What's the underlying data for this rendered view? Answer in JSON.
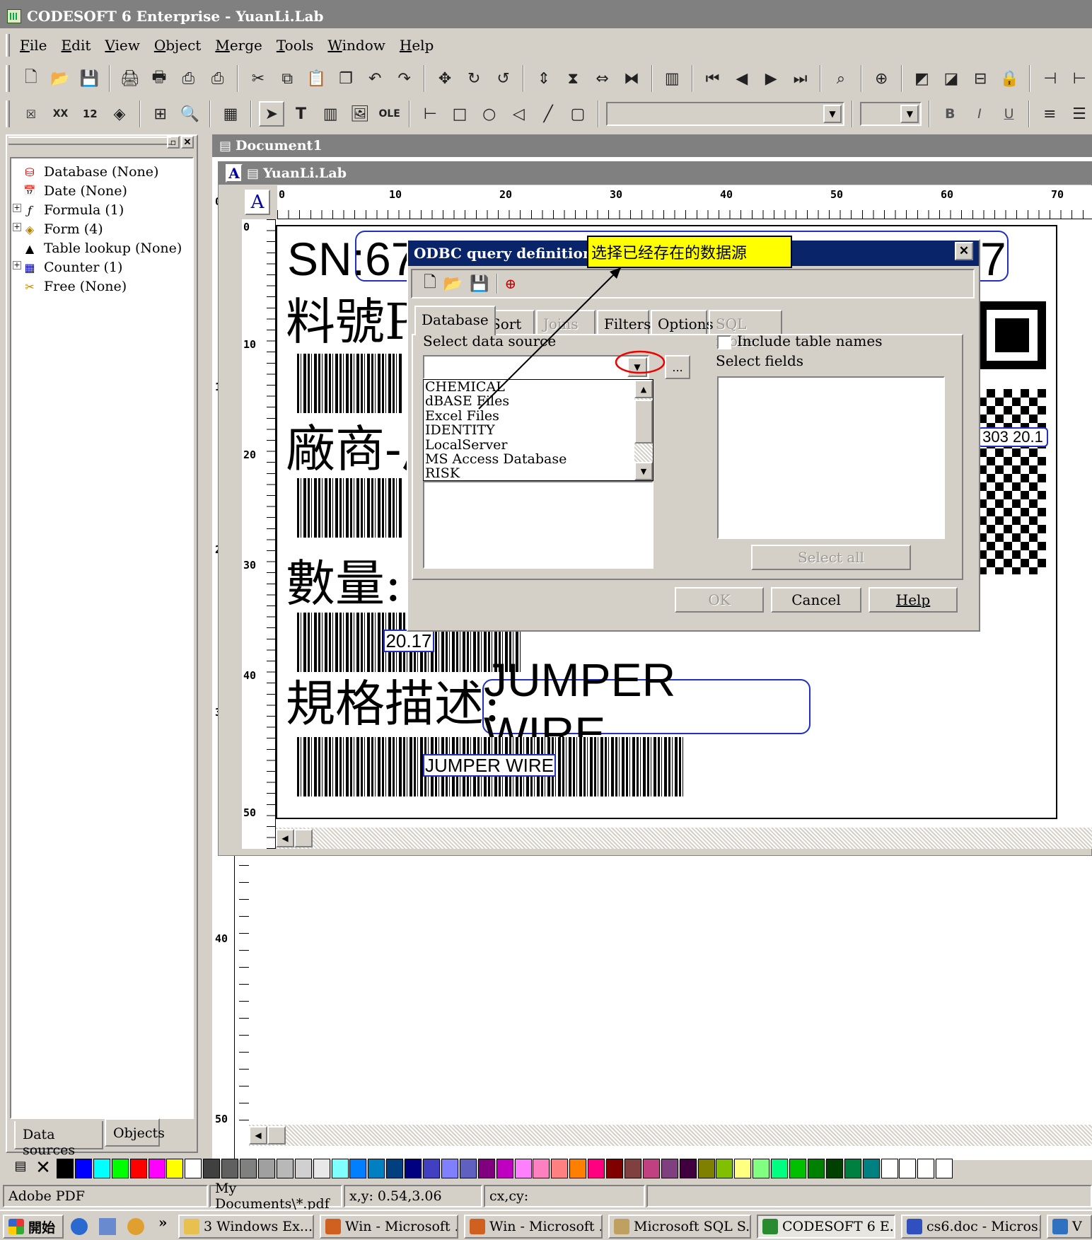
{
  "app": {
    "title": "CODESOFT 6 Enterprise - YuanLi.Lab"
  },
  "menu": [
    "File",
    "Edit",
    "View",
    "Object",
    "Merge",
    "Tools",
    "Window",
    "Help"
  ],
  "toolbar2": {
    "font_combo": "",
    "size_combo": "",
    "bold": "B",
    "italic": "I",
    "underline": "U"
  },
  "tree": {
    "items": [
      {
        "icon": "database-icon",
        "label": "Database (None)"
      },
      {
        "icon": "date-icon",
        "label": "Date (None)"
      },
      {
        "icon": "formula-icon",
        "label": "Formula (1)"
      },
      {
        "icon": "form-icon",
        "label": "Form (4)"
      },
      {
        "icon": "table-lookup-icon",
        "label": "Table lookup (None)"
      },
      {
        "icon": "counter-icon",
        "label": "Counter (1)"
      },
      {
        "icon": "free-icon",
        "label": "Free (None)"
      }
    ],
    "tabs": [
      "Data sources",
      "Objects"
    ]
  },
  "document": {
    "outer_title": "Document1",
    "inner_title": "YuanLi.Lab",
    "ruler_h": [
      "0",
      "10",
      "20",
      "30",
      "40",
      "50",
      "60",
      "70"
    ],
    "ruler_v_inner": [
      "0",
      "10",
      "20",
      "30",
      "40",
      "50"
    ],
    "ruler_v_outer": [
      "0",
      "10",
      "20",
      "30",
      "40",
      "50"
    ]
  },
  "label": {
    "sn_prefix": "SN:",
    "sn_value_left": "67",
    "sn_value_right": "7",
    "part_label": "料號PA",
    "vendor_label": "廠商-后",
    "qty_label": "數量:",
    "qty_value": "20.17",
    "desc_label": "規格描述:",
    "desc_value": "JUMPER WIRE",
    "barcode_text": "JUMPER WIRE",
    "qr_text": "303 20.1"
  },
  "dialog": {
    "title": "ODBC query definition",
    "tabs": [
      "Database",
      "Sort",
      "Joins",
      "Filters",
      "Options",
      "SQL mode"
    ],
    "select_source_label": "Select data source",
    "source_value": "",
    "browse_label": "...",
    "sources": [
      "CHEMICAL",
      "dBASE Files",
      "Excel Files",
      "IDENTITY",
      "LocalServer",
      "MS Access Database",
      "RISK"
    ],
    "include_table_names": "Include table names",
    "select_fields_label": "Select fields",
    "select_all": "Select all",
    "ok": "OK",
    "cancel": "Cancel",
    "help": "Help"
  },
  "annotation": {
    "callout": "选择已经存在的数据源"
  },
  "palette": {
    "colors": [
      "#000000",
      "#0000ff",
      "#00ffff",
      "#00ff00",
      "#ff0000",
      "#ff00ff",
      "#ffff00",
      "#ffffff",
      "#404040",
      "#606060",
      "#808080",
      "#a0a0a0",
      "#b8b8b8",
      "#d0d0d0",
      "#e8e8e8",
      "#80ffff",
      "#0080ff",
      "#0080c0",
      "#004080",
      "#000080",
      "#4040c0",
      "#8080ff",
      "#6060c0",
      "#800080",
      "#c000c0",
      "#ff80ff",
      "#ff80c0",
      "#ff8080",
      "#ff8000",
      "#ff0080",
      "#800000",
      "#804040",
      "#c04080",
      "#804080",
      "#400040",
      "#808000",
      "#80c000",
      "#ffff80",
      "#80ff80",
      "#00ff80",
      "#00c000",
      "#008000",
      "#004000",
      "#008040",
      "#008080",
      "#ffffff",
      "#ffffff",
      "#ffffff",
      "#ffffff"
    ]
  },
  "status": {
    "printer": "Adobe PDF",
    "path": "My Documents\\*.pdf",
    "xy": "x,y: 0.54,3.06",
    "cxcy": "cx,cy:"
  },
  "taskbar": {
    "start": "開始",
    "more": "»",
    "tasks": [
      {
        "label": "3 Windows Ex...",
        "color": "#e8c050"
      },
      {
        "label": "Win - Microsoft ...",
        "color": "#d06020"
      },
      {
        "label": "Win - Microsoft ...",
        "color": "#d06020"
      },
      {
        "label": "Microsoft SQL S...",
        "color": "#c0a060"
      },
      {
        "label": "CODESOFT 6 E...",
        "color": "#2a8a30"
      },
      {
        "label": "cs6.doc - Micros...",
        "color": "#3050c0"
      },
      {
        "label": "V",
        "color": "#3070c0"
      }
    ]
  }
}
